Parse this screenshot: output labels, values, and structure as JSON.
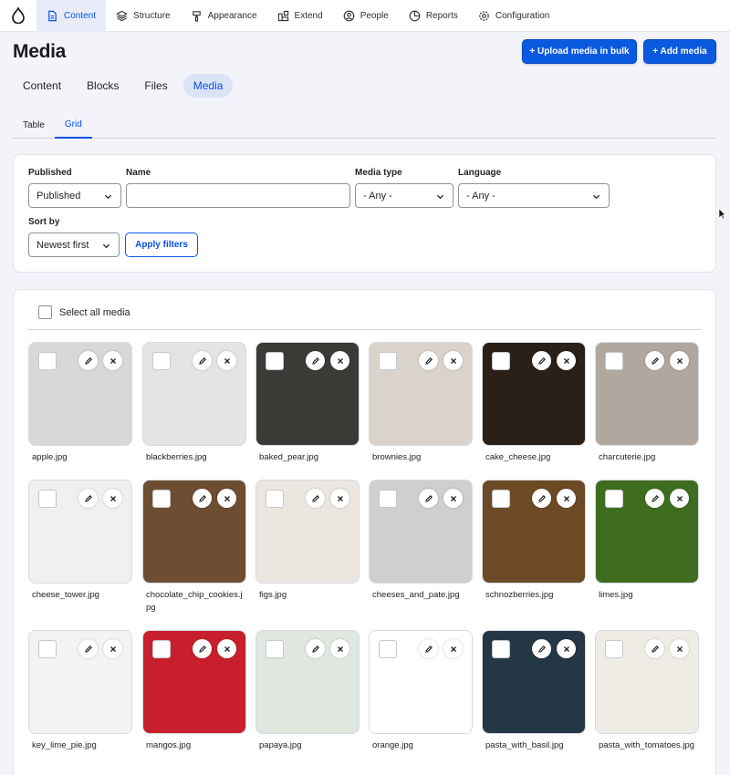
{
  "toolbar": {
    "items": [
      {
        "label": "Content",
        "icon": "content-icon",
        "active": true
      },
      {
        "label": "Structure",
        "icon": "structure-icon"
      },
      {
        "label": "Appearance",
        "icon": "appearance-icon"
      },
      {
        "label": "Extend",
        "icon": "extend-icon"
      },
      {
        "label": "People",
        "icon": "people-icon"
      },
      {
        "label": "Reports",
        "icon": "reports-icon"
      },
      {
        "label": "Configuration",
        "icon": "configuration-icon"
      }
    ]
  },
  "header": {
    "title": "Media",
    "upload_bulk_label": "+ Upload media in bulk",
    "add_media_label": "+ Add media"
  },
  "primary_tabs": [
    "Content",
    "Blocks",
    "Files",
    "Media"
  ],
  "primary_active": "Media",
  "secondary_tabs": [
    "Table",
    "Grid"
  ],
  "secondary_active": "Grid",
  "filters": {
    "published_label": "Published",
    "published_value": "Published",
    "name_label": "Name",
    "name_value": "",
    "media_type_label": "Media type",
    "media_type_value": "- Any -",
    "language_label": "Language",
    "language_value": "- Any -",
    "sort_label": "Sort by",
    "sort_value": "Newest first",
    "apply_label": "Apply filters"
  },
  "media": {
    "select_all_label": "Select all media",
    "items": [
      {
        "name": "apple.jpg",
        "color": "#d8d8d8"
      },
      {
        "name": "blackberries.jpg",
        "color": "#e4e4e4"
      },
      {
        "name": "baked_pear.jpg",
        "color": "#3b3a37"
      },
      {
        "name": "brownies.jpg",
        "color": "#d9d3cc"
      },
      {
        "name": "cake_cheese.jpg",
        "color": "#2a2018"
      },
      {
        "name": "charcuterie.jpg",
        "color": "#b0a89e"
      },
      {
        "name": "cheese_tower.jpg",
        "color": "#f0f0f0"
      },
      {
        "name": "chocolate_chip_cookies.jpg",
        "color": "#6e4e33"
      },
      {
        "name": "figs.jpg",
        "color": "#ece6e0"
      },
      {
        "name": "cheeses_and_pate.jpg",
        "color": "#cfcfd2"
      },
      {
        "name": "schnozberries.jpg",
        "color": "#6b4a25"
      },
      {
        "name": "limes.jpg",
        "color": "#3f6d1f"
      },
      {
        "name": "key_lime_pie.jpg",
        "color": "#f3f3f3"
      },
      {
        "name": "mangos.jpg",
        "color": "#c7202c"
      },
      {
        "name": "papaya.jpg",
        "color": "#dfe7df"
      },
      {
        "name": "orange.jpg",
        "color": "#ffffff"
      },
      {
        "name": "pasta_with_basil.jpg",
        "color": "#243744"
      },
      {
        "name": "pasta_with_tomatoes.jpg",
        "color": "#efece6"
      }
    ]
  },
  "colors": {
    "accent": "#0550e6",
    "primary_button": "#0a5ae0",
    "background": "#f3f4f9"
  }
}
